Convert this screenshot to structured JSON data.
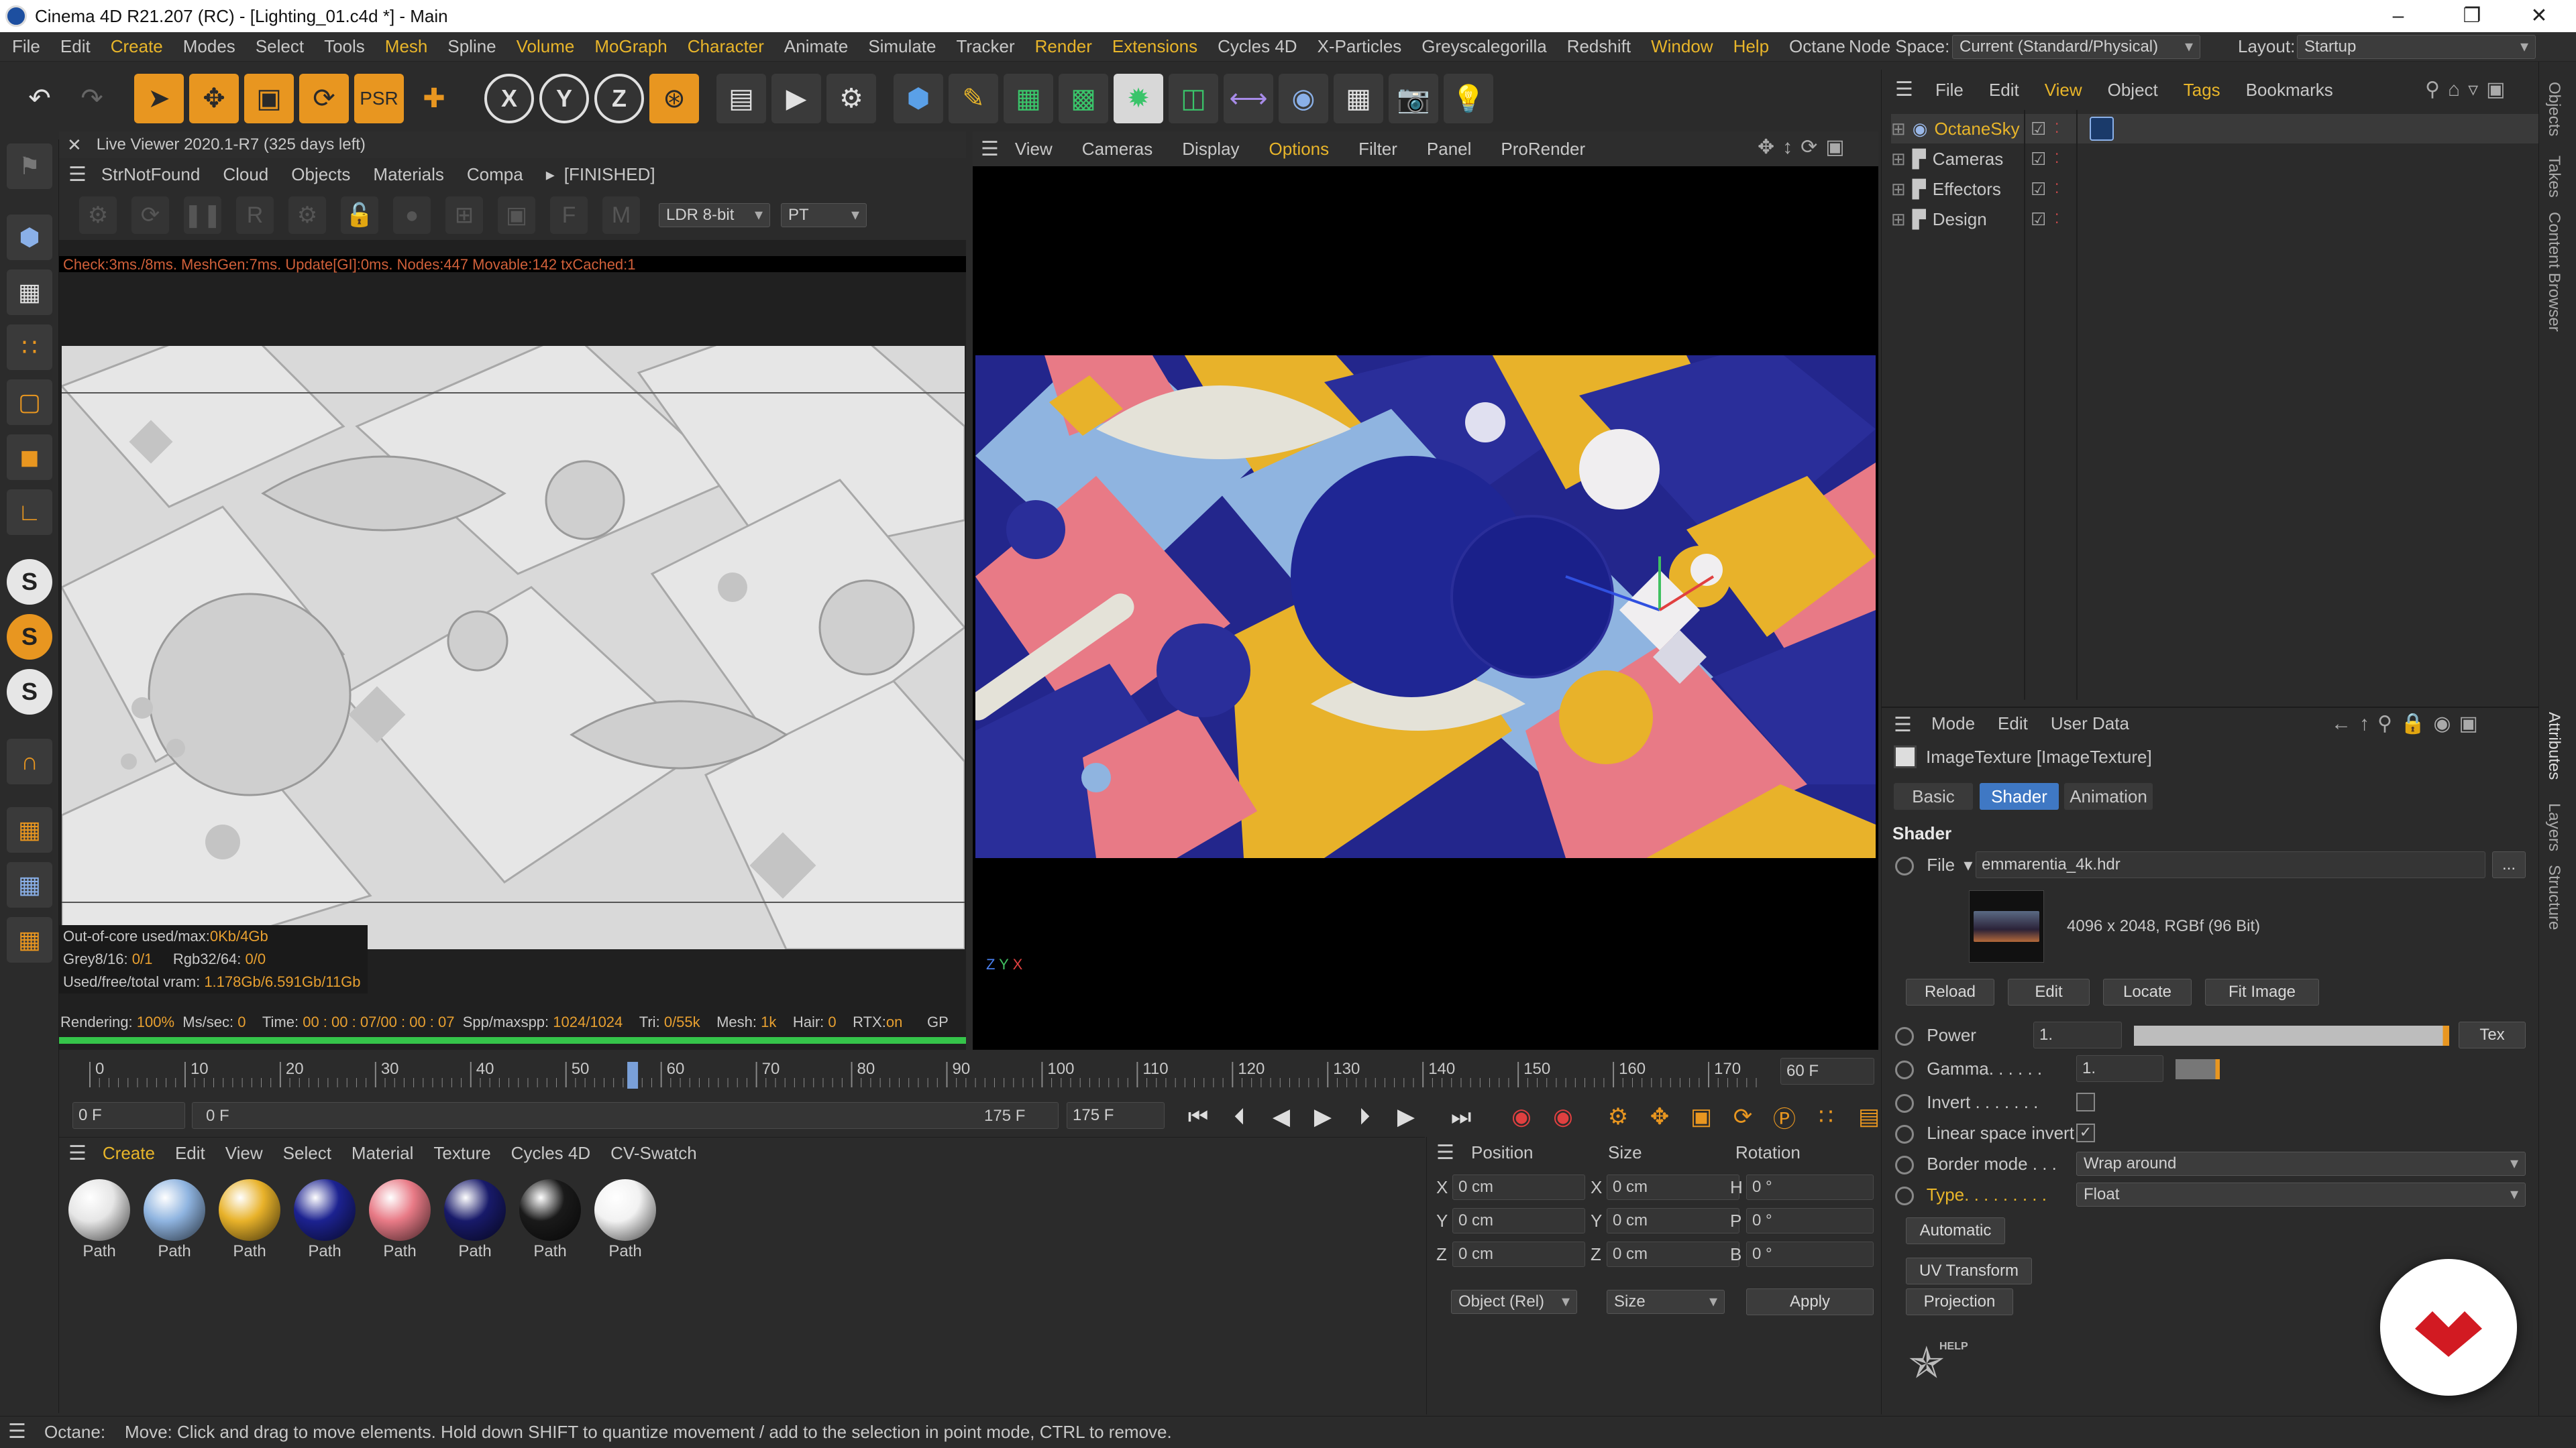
{
  "window": {
    "title": "Cinema 4D R21.207 (RC) - [Lighting_01.c4d *] - Main"
  },
  "menubar": {
    "items": [
      "File",
      "Edit",
      "Create",
      "Modes",
      "Select",
      "Tools",
      "Mesh",
      "Spline",
      "Volume",
      "MoGraph",
      "Character",
      "Animate",
      "Simulate",
      "Tracker",
      "Render",
      "Extensions",
      "Cycles 4D",
      "X-Particles",
      "Greyscalegorilla",
      "Redshift",
      "Window",
      "Help",
      "Octane"
    ],
    "node_space_label": "Node Space:",
    "node_space_value": "Current (Standard/Physical)",
    "layout_label": "Layout:",
    "layout_value": "Startup"
  },
  "live_viewer": {
    "title": "Live Viewer 2020.1-R7 (325 days left)",
    "menu": [
      "StrNotFound",
      "Cloud",
      "Objects",
      "Materials",
      "Compa"
    ],
    "state": "[FINISHED]",
    "ldr": "LDR 8-bit",
    "mode": "PT",
    "status_line": "Check:3ms./8ms. MeshGen:7ms. Update[GI]:0ms. Nodes:447 Movable:142 txCached:1",
    "stats": [
      {
        "label": "Out-of-core used/max:",
        "value": "0Kb/4Gb"
      },
      {
        "label": "Grey8/16: ",
        "value": "0/1",
        "label2": "     Rgb32/64: ",
        "value2": "0/0"
      },
      {
        "label": "Used/free/total vram: ",
        "value": "1.178Gb/6.591Gb/11Gb"
      }
    ],
    "render": {
      "rendering_label": "Rendering:",
      "rendering": "100%",
      "mssec_label": "Ms/sec:",
      "mssec": "0",
      "time_label": "Time:",
      "time": "00 : 00 : 07/00 : 00 : 07",
      "spp_label": "Spp/maxspp:",
      "spp": "1024/1024",
      "tri_label": "Tri:",
      "tri": "0/55k",
      "mesh_label": "Mesh:",
      "mesh": "1k",
      "hair_label": "Hair:",
      "hair": "0",
      "rtx_label": "RTX:",
      "rtx": "on",
      "gp": "GP"
    }
  },
  "viewport": {
    "menu": [
      "View",
      "Cameras",
      "Display",
      "Options",
      "Filter",
      "Panel",
      "ProRender"
    ],
    "highlighted": "Options",
    "axis": {
      "z": "Z",
      "y": "Y",
      "x": "X"
    }
  },
  "timeline": {
    "ticks": [
      "0",
      "10",
      "20",
      "30",
      "40",
      "50",
      "60",
      "70",
      "80",
      "90",
      "100",
      "110",
      "120",
      "130",
      "140",
      "150",
      "160",
      "170"
    ],
    "current_frame": 57,
    "max_frame": 175,
    "end_label": "60 F",
    "start_field": "0 F",
    "range_start": "0 F",
    "range_end": "175 F",
    "end_field": "175 F"
  },
  "materials": {
    "menu": [
      "Create",
      "Edit",
      "View",
      "Select",
      "Material",
      "Texture",
      "Cycles 4D",
      "CV-Swatch"
    ],
    "items": [
      {
        "label": "Path",
        "color": "#e6e6e6"
      },
      {
        "label": "Path",
        "color": "#8fb4e0"
      },
      {
        "label": "Path",
        "color": "#e8b22a"
      },
      {
        "label": "Path",
        "color": "#1c2290"
      },
      {
        "label": "Path",
        "color": "#e87a86"
      },
      {
        "label": "Path",
        "color": "#181a6a"
      },
      {
        "label": "Path",
        "color": "#1a1a1a"
      },
      {
        "label": "Path",
        "color": "#f2f2f2"
      }
    ]
  },
  "coordinates": {
    "headers": [
      "Position",
      "Size",
      "Rotation"
    ],
    "rows": [
      {
        "axis": "X",
        "pos": "0 cm",
        "saxis": "X",
        "size": "0 cm",
        "raxis": "H",
        "rot": "0 °"
      },
      {
        "axis": "Y",
        "pos": "0 cm",
        "saxis": "Y",
        "size": "0 cm",
        "raxis": "P",
        "rot": "0 °"
      },
      {
        "axis": "Z",
        "pos": "0 cm",
        "saxis": "Z",
        "size": "0 cm",
        "raxis": "B",
        "rot": "0 °"
      }
    ],
    "mode": "Object (Rel)",
    "size_mode": "Size",
    "apply": "Apply"
  },
  "objects": {
    "menu": [
      "File",
      "Edit",
      "View",
      "Object",
      "Tags",
      "Bookmarks"
    ],
    "highlighted": "View",
    "items": [
      {
        "name": "OctaneSky",
        "selected": true
      },
      {
        "name": "Cameras"
      },
      {
        "name": "Effectors"
      },
      {
        "name": "Design"
      }
    ]
  },
  "attributes": {
    "menu": [
      "Mode",
      "Edit",
      "User Data"
    ],
    "title": "ImageTexture [ImageTexture]",
    "tabs": [
      "Basic",
      "Shader",
      "Animation"
    ],
    "active_tab": "Shader",
    "section": "Shader",
    "file_label": "File",
    "file_value": "emmarentia_4k.hdr",
    "file_btn": "...",
    "image_info": "4096 x 2048, RGBf (96 Bit)",
    "buttons": [
      "Reload",
      "Edit",
      "Locate",
      "Fit Image"
    ],
    "power_label": "Power",
    "power_value": "1.",
    "power_btn": "Tex",
    "gamma_label": "Gamma. . . . . .",
    "gamma_value": "1.",
    "invert_label": "Invert . . . . . . .",
    "linear_label": "Linear space invert",
    "border_label": "Border mode . . .",
    "border_value": "Wrap around",
    "type_label": "Type. . . . . . . . .",
    "type_value": "Float",
    "automatic": "Automatic",
    "uv_transform": "UV Transform",
    "projection": "Projection",
    "help": "HELP"
  },
  "sidetabs": [
    "Objects",
    "Takes",
    "Content Browser",
    "Attributes",
    "Layers",
    "Structure"
  ],
  "status": {
    "text": "Octane:    Move: Click and drag to move elements. Hold down SHIFT to quantize movement / add to the selection in point mode, CTRL to remove."
  },
  "colors": {
    "accent": "#e8b52a",
    "tab_active": "#3f78c4",
    "progress": "#35c44a",
    "stat_value": "#e8a030"
  }
}
